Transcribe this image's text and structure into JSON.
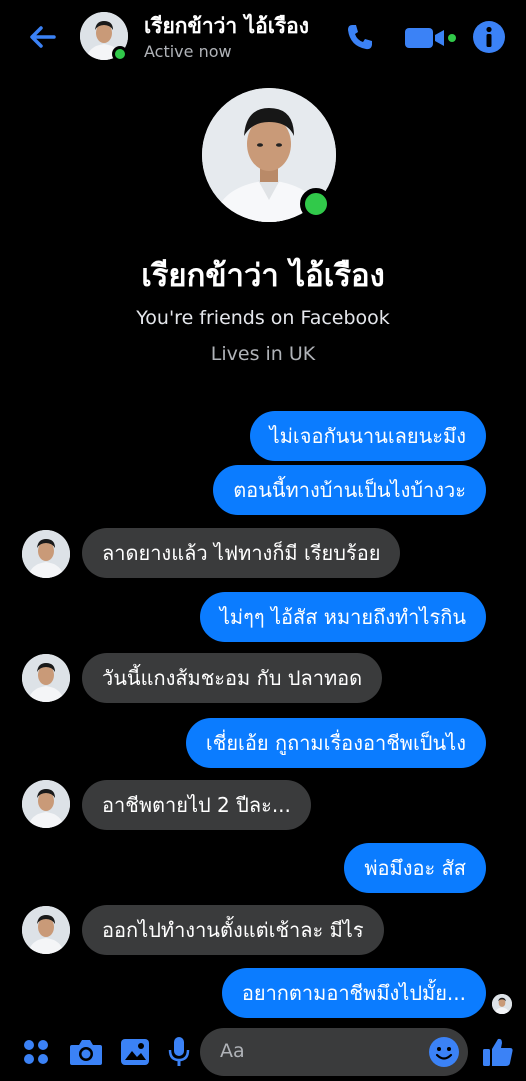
{
  "header": {
    "name": "เรียกข้าว่า ไอ้เรือง",
    "status": "Active now"
  },
  "profile": {
    "name": "เรียกข้าว่า ไอ้เรือง",
    "friends_text": "You're friends on Facebook",
    "location_text": "Lives in UK"
  },
  "messages": [
    {
      "dir": "out",
      "text": "ไม่เจอกันนานเลยนะมึง"
    },
    {
      "dir": "out",
      "text": "ตอนนี้ทางบ้านเป็นไงบ้างวะ"
    },
    {
      "dir": "in",
      "text": "ลาดยางแล้ว ไฟทางก็มี เรียบร้อย"
    },
    {
      "dir": "out",
      "text": "ไม่ๆๆ ไอ้สัส หมายถึงทำไรกิน"
    },
    {
      "dir": "in",
      "text": "วันนี้แกงส้มชะอม กับ ปลาทอด"
    },
    {
      "dir": "out",
      "text": "เชี่ยเอ้ย กูถามเรื่องอาชีพเป็นไง"
    },
    {
      "dir": "in",
      "text": "อาชีพตายไป 2 ปีละ..."
    },
    {
      "dir": "out",
      "text": "พ่อมึงอะ สัส"
    },
    {
      "dir": "in",
      "text": "ออกไปทำงานตั้งแต่เช้าละ มีไร"
    },
    {
      "dir": "out",
      "text": "อยากตามอาชีพมึงไปมั้ย..."
    }
  ],
  "composer": {
    "placeholder": "Aa"
  },
  "colors": {
    "accent": "#0b7cff",
    "incoming_bubble": "#3a3b3c",
    "online": "#31c94a",
    "background": "#000000"
  },
  "icons": [
    "back-arrow-icon",
    "phone-icon",
    "video-camera-icon",
    "info-icon",
    "apps-grid-icon",
    "camera-icon",
    "gallery-icon",
    "microphone-icon",
    "emoji-icon",
    "thumbs-up-icon"
  ]
}
